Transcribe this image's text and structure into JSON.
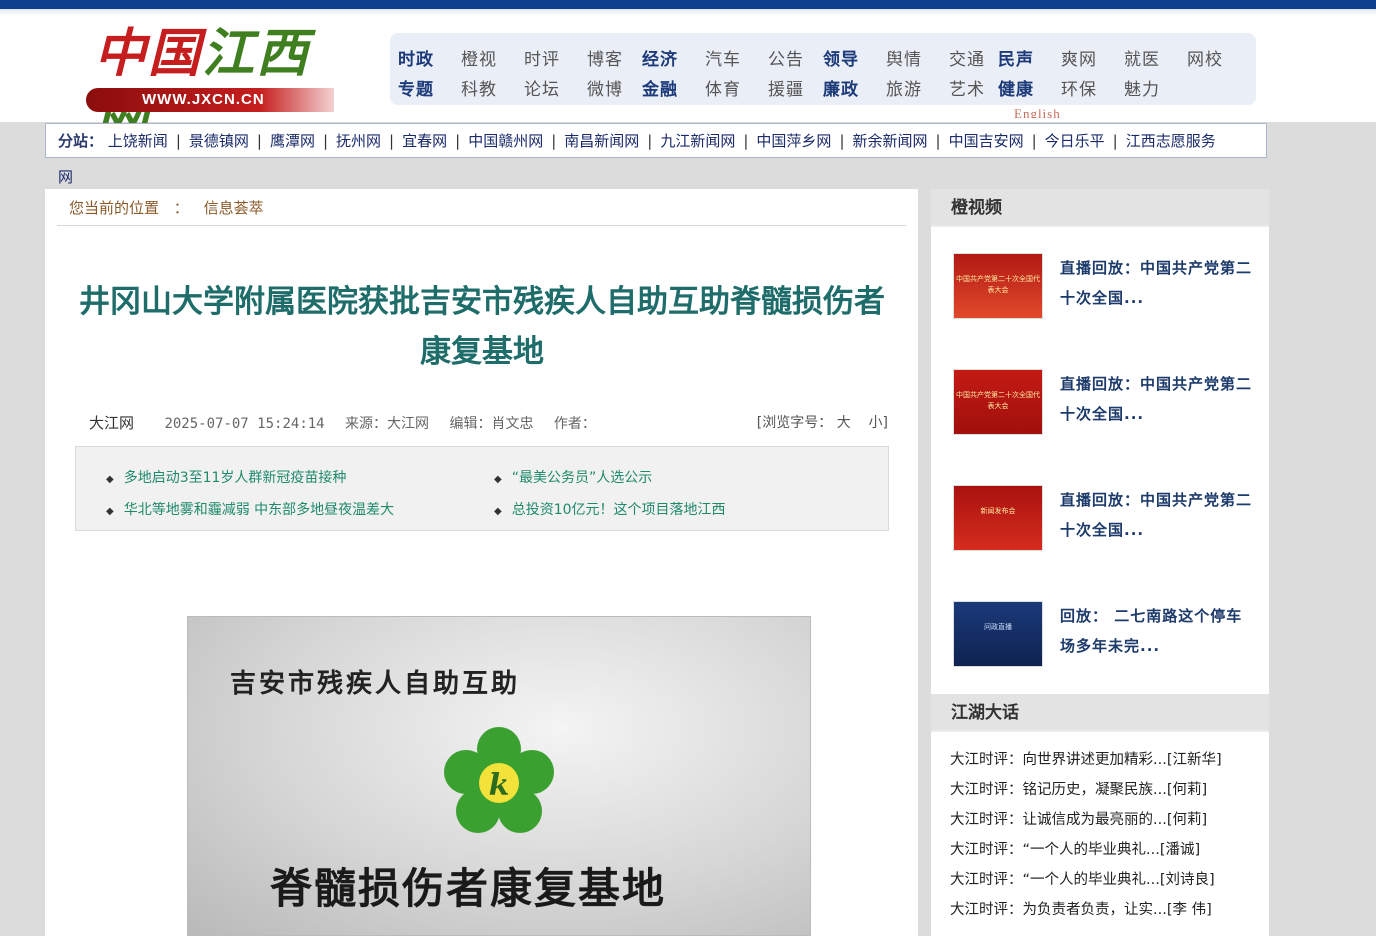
{
  "logo": {
    "cn": "中国江西网",
    "url": "WWW.JXCN.CN"
  },
  "nav": {
    "row1": [
      {
        "label": "时政",
        "bold": true
      },
      {
        "label": "橙视",
        "bold": false
      },
      {
        "label": "时评",
        "bold": false
      },
      {
        "label": "博客",
        "bold": false
      },
      {
        "label": "经济",
        "bold": true
      },
      {
        "label": "汽车",
        "bold": false
      },
      {
        "label": "公告",
        "bold": false
      },
      {
        "label": "领导",
        "bold": true
      },
      {
        "label": "舆情",
        "bold": false
      },
      {
        "label": "交通",
        "bold": false
      },
      {
        "label": "民声",
        "bold": true
      },
      {
        "label": "爽网",
        "bold": false
      },
      {
        "label": "就医",
        "bold": false
      },
      {
        "label": "网校",
        "bold": false
      }
    ],
    "row2": [
      {
        "label": "专题",
        "bold": true
      },
      {
        "label": "科教",
        "bold": false
      },
      {
        "label": "论坛",
        "bold": false
      },
      {
        "label": "微博",
        "bold": false
      },
      {
        "label": "金融",
        "bold": true
      },
      {
        "label": "体育",
        "bold": false
      },
      {
        "label": "援疆",
        "bold": false
      },
      {
        "label": "廉政",
        "bold": true
      },
      {
        "label": "旅游",
        "bold": false
      },
      {
        "label": "艺术",
        "bold": false
      },
      {
        "label": "健康",
        "bold": true
      },
      {
        "label": "环保",
        "bold": false
      },
      {
        "label": "魅力",
        "bold": false
      }
    ],
    "english": "English"
  },
  "substations": {
    "label": "分站：",
    "items": [
      "上饶新闻",
      "景德镇网",
      "鹰潭网",
      "抚州网",
      "宜春网",
      "中国赣州网",
      "南昌新闻网",
      "九江新闻网",
      "中国萍乡网",
      "新余新闻网",
      "中国吉安网",
      "今日乐平",
      "江西志愿服务"
    ],
    "wrap": "网"
  },
  "breadcrumb": {
    "label": "您当前的位置",
    "sep": "：",
    "section": "信息荟萃"
  },
  "article": {
    "title": "井冈山大学附属医院获批吉安市残疾人自助互助脊髓损伤者康复基地",
    "site": "大江网",
    "datetime": "2025-07-07 15:24:14",
    "source": "来源：大江网",
    "editor": "编辑：肖文忠",
    "author": "作者：",
    "fontsize_label": "[浏览字号：",
    "font_large": "大",
    "font_small": "小]"
  },
  "related": [
    "多地启动3至11岁人群新冠疫苗接种",
    "“最美公务员”人选公示",
    "华北等地雾和霾减弱 中东部多地昼夜温差大",
    "总投资10亿元！这个项目落地江西"
  ],
  "photo": {
    "line1": "吉安市残疾人自助互助",
    "line2": "脊髓损伤者康复基地"
  },
  "sidebar": {
    "video_head": "橙视频",
    "videos": [
      {
        "title": "直播回放：中国共产党第二十次全国...",
        "thumb": "中国共产党第二十次全国代表大会"
      },
      {
        "title": "直播回放：中国共产党第二十次全国...",
        "thumb": "中国共产党第二十次全国代表大会"
      },
      {
        "title": "直播回放：中国共产党第二十次全国...",
        "thumb": "新闻发布会"
      },
      {
        "title": "回放： 二七南路这个停车场多年未完...",
        "thumb": "问政直播"
      }
    ],
    "talk_head": "江湖大话",
    "talks": [
      "大江时评：向世界讲述更加精彩...[江新华]",
      "大江时评：铭记历史，凝聚民族...[何莉]",
      "大江时评：让诚信成为最亮丽的...[何莉]",
      "大江时评：“一个人的毕业典礼...[潘诚]",
      "大江时评：“一个人的毕业典礼...[刘诗良]",
      "大江时评：为负责者负责，让实...[李 伟]"
    ]
  },
  "colors": {
    "topbar": "#0d3f8f",
    "title": "#1f6d6a",
    "link": "#1f8a6a",
    "nav_bold": "#1d3b7a"
  }
}
